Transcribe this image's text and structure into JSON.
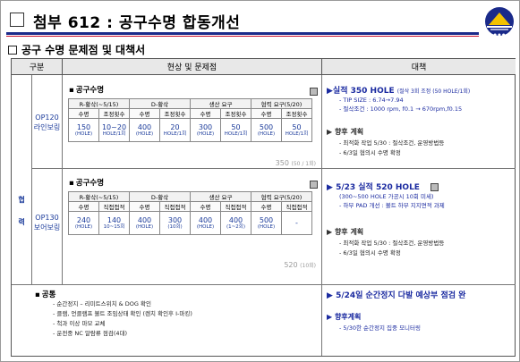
{
  "header": {
    "title": "첨부 612 : 공구수명 합동개선",
    "section": "공구 수명 문제점 및 대책서"
  },
  "table": {
    "col_headers": [
      "구분",
      "현상 및 문제점",
      "대책"
    ],
    "category": "협\n력",
    "rows": [
      {
        "label": "OP120\n라인보링",
        "item_title": "공구수명",
        "sub_headers": [
          "R-황삭(~5/15)",
          "D-황삭",
          "생산 요구",
          "협력 요구(5/20)"
        ],
        "sub_cols": [
          "수명",
          "조정횟수",
          "수명",
          "조정횟수",
          "수명",
          "조정횟수",
          "수명",
          "조정횟수"
        ],
        "values": [
          {
            "v": "150",
            "u": "(HOLE)"
          },
          {
            "v": "10~20",
            "u": "HOLE/1회"
          },
          {
            "v": "400",
            "u": "(HOLE)"
          },
          {
            "v": "20",
            "u": "HOLE/1회"
          },
          {
            "v": "300",
            "u": "(HOLE)"
          },
          {
            "v": "50",
            "u": "HOLE/1회"
          },
          {
            "v": "500",
            "u": "(HOLE)"
          },
          {
            "v": "50",
            "u": "HOLE/1회"
          }
        ],
        "total": "350",
        "total_unit": "(50 / 1회)",
        "measure_title": "실적 350 HOLE",
        "measure_sub": "(절삭 3회 조정 (50 HOLE/1회)",
        "measure_notes": [
          "- TIP SIZE : 6.74→7.94",
          "- 절삭조건 : 1000 rpm, f0.1 → 670rpm,f0.15"
        ],
        "plan_title": "향후 계획",
        "plan_items": [
          "- 최적화 작업 5/30 : 절삭조건, 운영방법등",
          "- 6/3일 협의시 수명 확정"
        ]
      },
      {
        "label": "OP130\n보어보링",
        "item_title": "공구수명",
        "sub_headers": [
          "R-황삭(~5/15)",
          "D-황삭",
          "생산 요구",
          "협력 요구(5/20)"
        ],
        "sub_cols": [
          "수명",
          "직접접적",
          "수명",
          "직접접적",
          "수명",
          "직접접적",
          "수명",
          "직접접적"
        ],
        "values": [
          {
            "v": "240",
            "u": "(HOLE)"
          },
          {
            "v": "140",
            "u": "10~15회"
          },
          {
            "v": "400",
            "u": "(HOLE)"
          },
          {
            "v": "300",
            "u": "(10회)"
          },
          {
            "v": "400",
            "u": "(HOLE)"
          },
          {
            "v": "400",
            "u": "(1~2회)"
          },
          {
            "v": "500",
            "u": "(HOLE)"
          },
          {
            "v": "-",
            "u": ""
          }
        ],
        "total": "520",
        "total_unit": "(10회)",
        "measure_title": "5/23 실적  520 HOLE",
        "measure_sub": "(300~500 HOLE 가공시 10회 미세)",
        "measure_notes": [
          "- 하부 PAD 개선 : 볼트 하부 지지면적 과제"
        ],
        "plan_title": "향후 계획",
        "plan_items": [
          "- 최적화 작업 5/30 : 절삭조건, 운영방법등",
          "- 6/3일 협의시 수명 확정"
        ]
      }
    ],
    "common": {
      "title": "공통",
      "items": [
        "- 순간정지 – 리미트스위치 & DOG 확인",
        "- 클램, 언클램프 볼트 조임상태 확인 (렌치 확인후 I-마킹)",
        "- 척과 이상 마모 교체",
        "- 운전중 NC 알람류 점검(4대)"
      ],
      "measure_title": "5/24일 순간정지 다발 예상부 점검 완",
      "plan_title": "향후계획",
      "plan_items": [
        "- 5/30한 순간정지 집중 모니터링"
      ]
    }
  },
  "colors": {
    "accent_blue": "#1a2aa0",
    "header_gray": "#e8e8e8",
    "title_rule": "#1a2a8a",
    "title_rule_red": "#c8102e"
  }
}
